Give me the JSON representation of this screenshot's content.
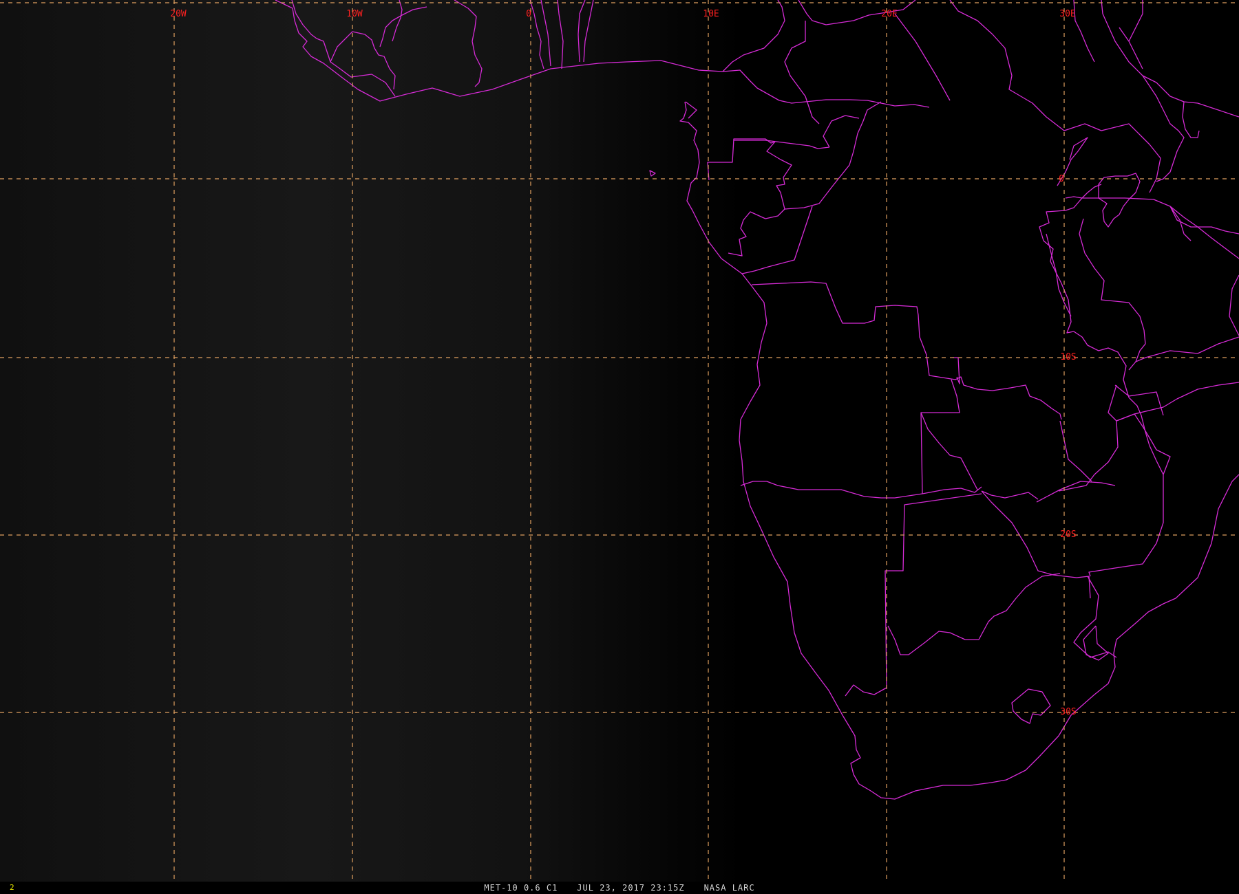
{
  "map": {
    "longitude_labels": [
      "20W",
      "10W",
      "0",
      "10E",
      "20E",
      "30E"
    ],
    "latitude_labels": [
      "0",
      "10S",
      "20S",
      "30S"
    ],
    "colors": {
      "background": "#000000",
      "graticule": "#e0a060",
      "graticule_label": "#ff2020",
      "boundaries": "#d62bd6"
    }
  },
  "status_bar": {
    "frame_number": "2",
    "satellite_band": "MET-10 0.6 C1",
    "datetime": "JUL 23, 2017 23:15Z",
    "source": "NASA LARC"
  }
}
